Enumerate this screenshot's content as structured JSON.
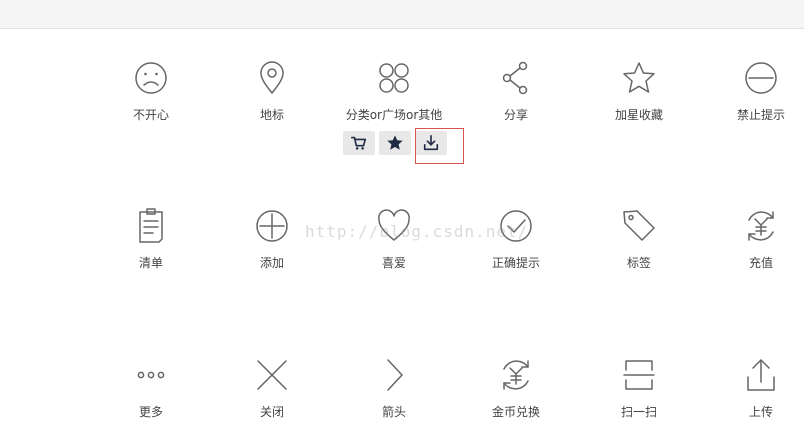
{
  "icons": {
    "row1": [
      {
        "label": "不开心",
        "icon": "sad-face-icon"
      },
      {
        "label": "地标",
        "icon": "location-pin-icon"
      },
      {
        "label": "分类or广场or其他",
        "icon": "grid-circles-icon"
      },
      {
        "label": "分享",
        "icon": "share-icon"
      },
      {
        "label": "加星收藏",
        "icon": "star-outline-icon"
      },
      {
        "label": "禁止提示",
        "icon": "minus-circle-icon"
      }
    ],
    "row2": [
      {
        "label": "清单",
        "icon": "clipboard-list-icon"
      },
      {
        "label": "添加",
        "icon": "plus-circle-icon"
      },
      {
        "label": "喜爱",
        "icon": "heart-icon"
      },
      {
        "label": "正确提示",
        "icon": "check-circle-icon"
      },
      {
        "label": "标签",
        "icon": "tag-icon"
      },
      {
        "label": "充值",
        "icon": "yuan-refresh-icon"
      }
    ],
    "row3": [
      {
        "label": "更多",
        "icon": "more-dots-icon"
      },
      {
        "label": "关闭",
        "icon": "close-x-icon"
      },
      {
        "label": "箭头",
        "icon": "chevron-right-icon"
      },
      {
        "label": "金币兑换",
        "icon": "coin-exchange-icon"
      },
      {
        "label": "扫一扫",
        "icon": "scan-icon"
      },
      {
        "label": "上传",
        "icon": "upload-icon"
      }
    ]
  },
  "mini_toolbar": [
    "cart-icon",
    "star-filled-icon",
    "download-icon"
  ],
  "watermark": "http://blog.csdn.net/"
}
